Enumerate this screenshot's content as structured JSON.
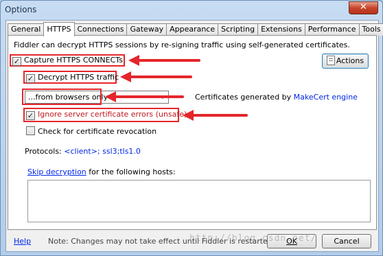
{
  "window": {
    "title": "Options",
    "close_glyph": "✕"
  },
  "tabs": [
    {
      "label": "General",
      "active": false
    },
    {
      "label": "HTTPS",
      "active": true
    },
    {
      "label": "Connections",
      "active": false
    },
    {
      "label": "Gateway",
      "active": false
    },
    {
      "label": "Appearance",
      "active": false
    },
    {
      "label": "Scripting",
      "active": false
    },
    {
      "label": "Extensions",
      "active": false
    },
    {
      "label": "Performance",
      "active": false
    },
    {
      "label": "Tools",
      "active": false
    }
  ],
  "https": {
    "description": "Fiddler can decrypt HTTPS sessions by re-signing traffic using self-generated certificates.",
    "actions_label": "Actions",
    "capture_label": "Capture HTTPS CONNECTs",
    "capture_checked": true,
    "decrypt_label": "Decrypt HTTPS traffic",
    "decrypt_checked": true,
    "source_selected": "...from browsers only",
    "cert_prefix": "Certificates generated by ",
    "cert_link": "MakeCert engine",
    "ignore_label": "Ignore server certificate errors (unsafe)",
    "ignore_checked": true,
    "revocation_label": "Check for certificate revocation",
    "revocation_checked": false,
    "protocols_label": "Protocols: ",
    "protocols_value": "<client>; ssl3;tls1.0",
    "skip_link": "Skip decryption",
    "skip_suffix": " for the following hosts:",
    "skip_hosts_value": ""
  },
  "footer": {
    "help_label": "Help",
    "note": "Note: Changes may not take effect until Fiddler is restarted.",
    "ok_label": "OK",
    "cancel_label": "Cancel",
    "watermark": "http://blog.csdn.net/"
  },
  "colors": {
    "annotation_red": "#e5262b",
    "link_blue": "#0026e6"
  }
}
